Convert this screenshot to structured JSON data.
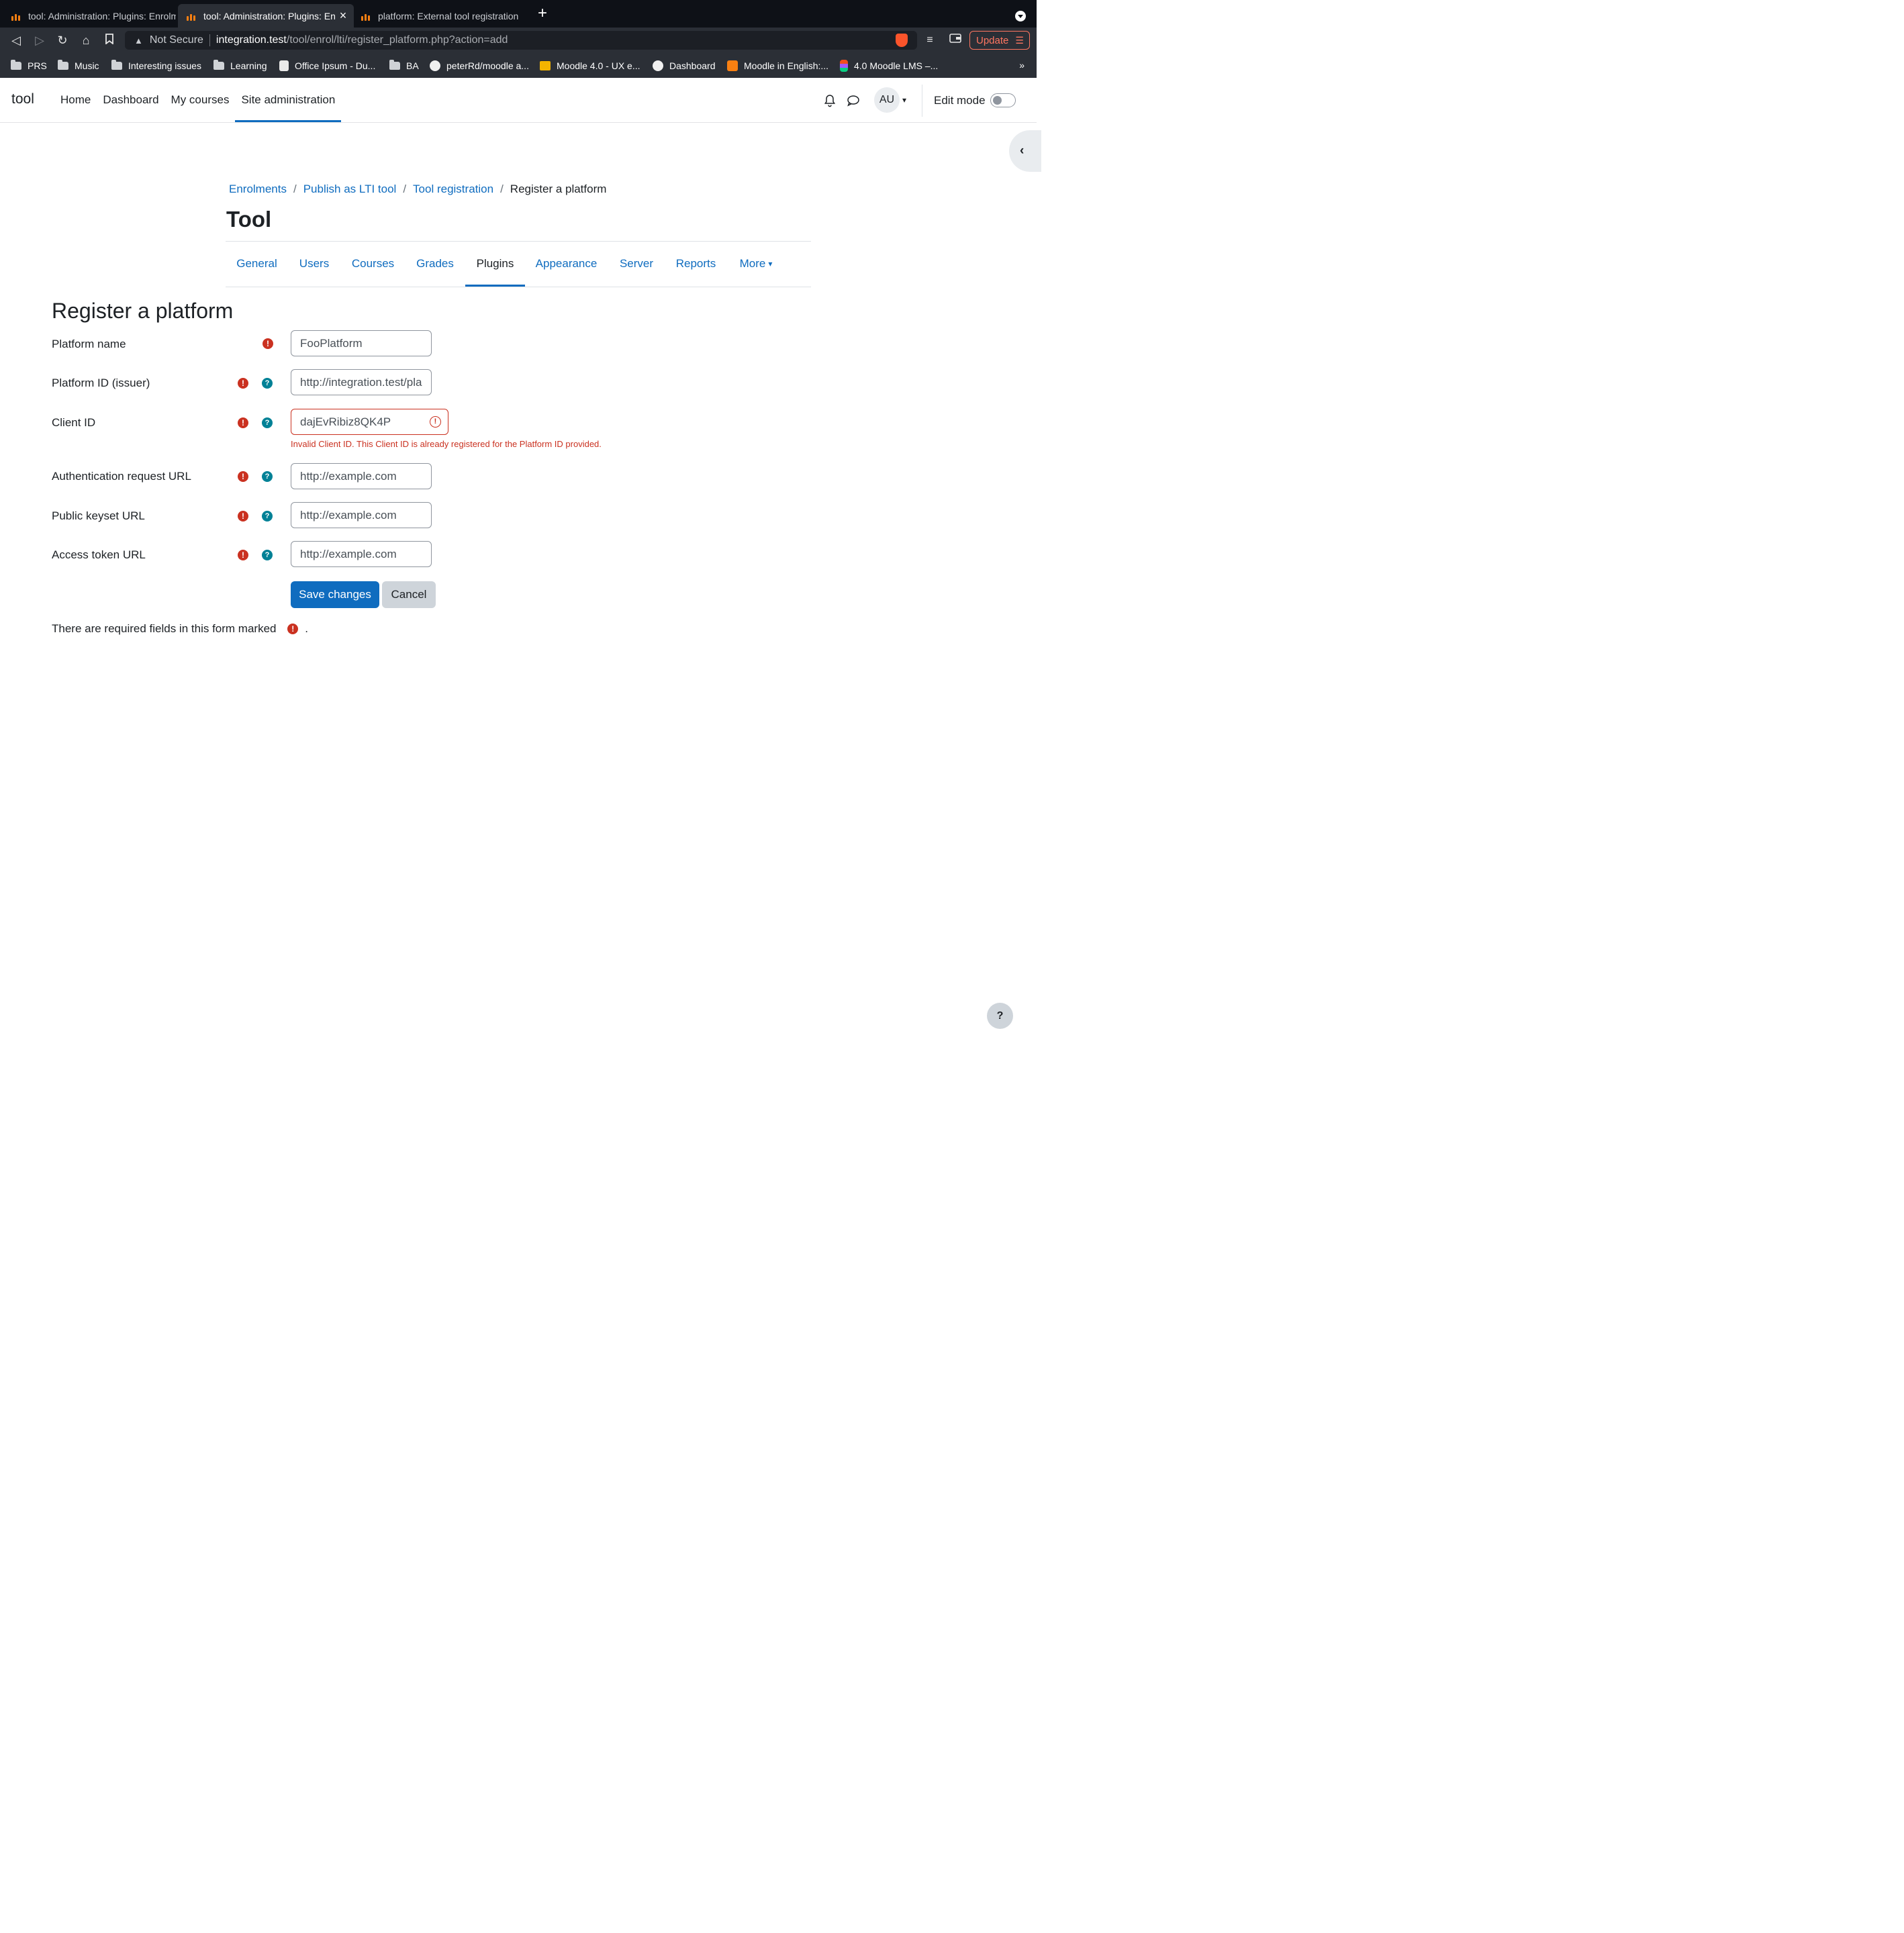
{
  "browser": {
    "tabs": [
      {
        "title": "tool: Administration: Plugins: Enrolm",
        "active": false
      },
      {
        "title": "tool: Administration: Plugins: En",
        "active": true
      },
      {
        "title": "platform: External tool registration",
        "active": false
      }
    ],
    "address": {
      "security_label": "Not Secure",
      "host": "integration.test",
      "path": "/tool/enrol/lti/register_platform.php?action=add"
    },
    "update_label": "Update",
    "bookmarks": [
      {
        "label": "PRS",
        "icon": "folder-icon"
      },
      {
        "label": "Music",
        "icon": "folder-icon"
      },
      {
        "label": "Interesting issues",
        "icon": "folder-icon"
      },
      {
        "label": "Learning",
        "icon": "folder-icon"
      },
      {
        "label": "Office Ipsum - Du...",
        "icon": "hand-icon"
      },
      {
        "label": "BA",
        "icon": "folder-icon"
      },
      {
        "label": "peterRd/moodle a...",
        "icon": "github-icon"
      },
      {
        "label": "Moodle 4.0 - UX e...",
        "icon": "slides-icon"
      },
      {
        "label": "Dashboard",
        "icon": "globe-icon"
      },
      {
        "label": "Moodle in English:...",
        "icon": "moodle-icon"
      },
      {
        "label": "4.0 Moodle LMS –...",
        "icon": "figma-icon"
      }
    ],
    "bookmarks_overflow": "»"
  },
  "navbar": {
    "brand": "tool",
    "items": [
      {
        "label": "Home",
        "active": false
      },
      {
        "label": "Dashboard",
        "active": false
      },
      {
        "label": "My courses",
        "active": false
      },
      {
        "label": "Site administration",
        "active": true
      }
    ],
    "avatar_initials": "AU",
    "edit_mode_label": "Edit mode",
    "edit_mode_on": false
  },
  "breadcrumb": [
    {
      "label": "Enrolments",
      "link": true
    },
    {
      "label": "Publish as LTI tool",
      "link": true
    },
    {
      "label": "Tool registration",
      "link": true
    },
    {
      "label": "Register a platform",
      "link": false
    }
  ],
  "page_title": "Tool",
  "secondary_nav": [
    {
      "label": "General",
      "active": false
    },
    {
      "label": "Users",
      "active": false
    },
    {
      "label": "Courses",
      "active": false
    },
    {
      "label": "Grades",
      "active": false
    },
    {
      "label": "Plugins",
      "active": true
    },
    {
      "label": "Appearance",
      "active": false
    },
    {
      "label": "Server",
      "active": false
    },
    {
      "label": "Reports",
      "active": false
    },
    {
      "label": "More",
      "active": false
    }
  ],
  "form": {
    "title": "Register a platform",
    "fields": [
      {
        "label": "Platform name",
        "value": "FooPlatform",
        "required": true,
        "help": false
      },
      {
        "label": "Platform ID (issuer)",
        "value": "http://integration.test/pla",
        "required": true,
        "help": true
      },
      {
        "label": "Client ID",
        "value": "dajEvRibiz8QK4P",
        "required": true,
        "help": true,
        "error": "Invalid Client ID. This Client ID is already registered for the Platform ID provided."
      },
      {
        "label": "Authentication request URL",
        "value": "http://example.com",
        "required": true,
        "help": true
      },
      {
        "label": "Public keyset URL",
        "value": "http://example.com",
        "required": true,
        "help": true
      },
      {
        "label": "Access token URL",
        "value": "http://example.com",
        "required": true,
        "help": true
      }
    ],
    "save_label": "Save changes",
    "cancel_label": "Cancel",
    "required_note": "There are required fields in this form marked",
    "required_note_end": "."
  },
  "help_fab": "?",
  "colors": {
    "primary": "#0f6cbf",
    "required": "#ca3120",
    "help": "#008196"
  }
}
